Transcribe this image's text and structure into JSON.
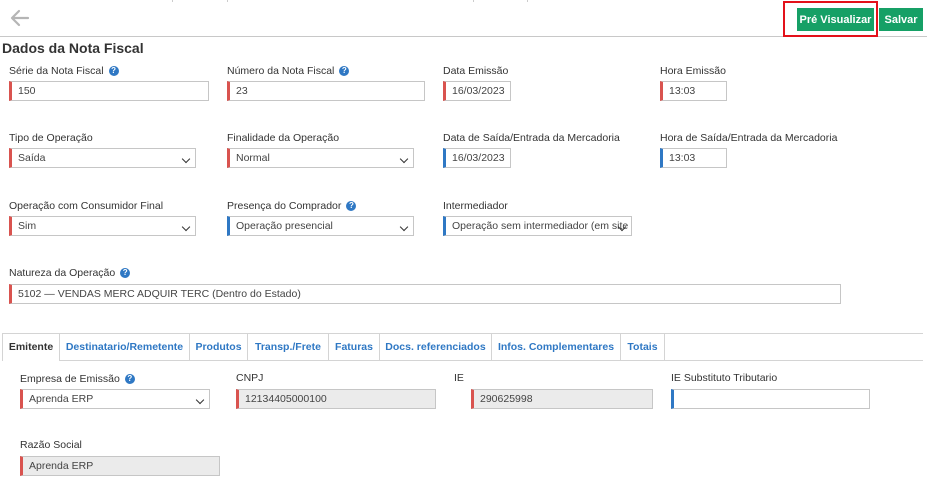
{
  "toolbar": {
    "preview_label": "Pré Visualizar",
    "save_label": "Salvar"
  },
  "section_title": "Dados da Nota Fiscal",
  "fields": {
    "serie": {
      "label": "Série da Nota Fiscal",
      "value": "150"
    },
    "numero": {
      "label": "Número da Nota Fiscal",
      "value": "23"
    },
    "data_emissao": {
      "label": "Data Emissão",
      "value": "16/03/2023"
    },
    "hora_emissao": {
      "label": "Hora Emissão",
      "value": "13:03"
    },
    "tipo_operacao": {
      "label": "Tipo de Operação",
      "value": "Saída"
    },
    "finalidade": {
      "label": "Finalidade da Operação",
      "value": "Normal"
    },
    "data_saida": {
      "label": "Data de Saída/Entrada da Mercadoria",
      "value": "16/03/2023"
    },
    "hora_saida": {
      "label": "Hora de Saída/Entrada da Mercadoria",
      "value": "13:03"
    },
    "consumidor_final": {
      "label": "Operação com Consumidor Final",
      "value": "Sim"
    },
    "presenca": {
      "label": "Presença do Comprador",
      "value": "Operação presencial"
    },
    "intermediador": {
      "label": "Intermediador",
      "value": "Operação sem intermediador (em site"
    },
    "natureza": {
      "label": "Natureza da Operação",
      "value": "5102 — VENDAS MERC ADQUIR TERC (Dentro do Estado)"
    }
  },
  "tabs": [
    "Emitente",
    "Destinatario/Remetente",
    "Produtos",
    "Transp./Frete",
    "Faturas",
    "Docs. referenciados",
    "Infos. Complementares",
    "Totais"
  ],
  "emitente": {
    "empresa": {
      "label": "Empresa de Emissão",
      "value": "Aprenda ERP"
    },
    "cnpj": {
      "label": "CNPJ",
      "value": "12134405000100"
    },
    "ie": {
      "label": "IE",
      "value": "290625998"
    },
    "ie_st": {
      "label": "IE Substituto Tributario",
      "value": ""
    },
    "razao_social": {
      "label": "Razão Social",
      "value": "Aprenda ERP"
    }
  },
  "icons": {
    "back": "arrow-left-icon",
    "help": "question-circle-icon",
    "dropdown": "chevron-down-icon"
  },
  "colors": {
    "accent_button": "#16a066",
    "required_marker": "#d9534f",
    "optional_marker": "#2f78c4",
    "link_blue": "#2f78c4",
    "highlight": "#e3111a"
  }
}
